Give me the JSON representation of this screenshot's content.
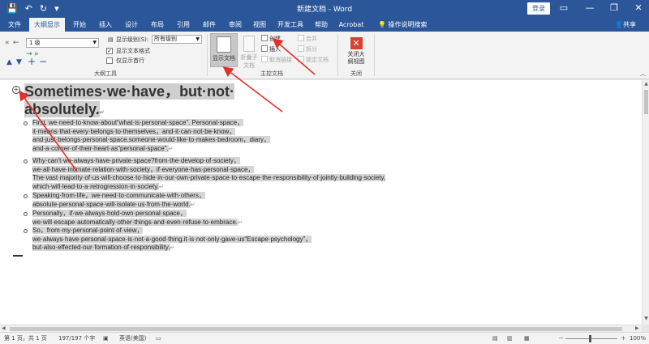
{
  "window": {
    "title": "新建文档 - Word",
    "login_label": "登录",
    "controls": [
      "▭",
      "—",
      "❐",
      "✕"
    ]
  },
  "qat": [
    "💾",
    "↶",
    "↻",
    "▾"
  ],
  "menu": {
    "tabs": [
      "文件",
      "大纲显示",
      "开始",
      "插入",
      "设计",
      "布局",
      "引用",
      "邮件",
      "审阅",
      "视图",
      "开发工具",
      "帮助",
      "Acrobat"
    ],
    "active_index": 1,
    "tellme": "操作说明搜索",
    "share": "共享"
  },
  "ribbon": {
    "outline_tools": {
      "level_value": "1 级",
      "show_level_label": "显示级别(S):",
      "show_level_value": "所有级别",
      "show_text_format": "显示文本格式",
      "show_first_line_only": "仅显示首行",
      "text_format_checked": true,
      "first_line_checked": false,
      "group_label": "大纲工具"
    },
    "master_document": {
      "show_document": "显示文档",
      "collapse_subdocs": "折叠子文档",
      "create": "创建",
      "insert": "插入",
      "unlink": "取消链接",
      "merge": "合并",
      "split": "拆分",
      "lock_document": "锁定文档",
      "group_label": "主控文档"
    },
    "close": {
      "close_outline_view": "关闭大纲视图",
      "group_label": "关闭"
    }
  },
  "document": {
    "heading_line1": "Sometimes·we·have，but·not·",
    "heading_line2": "absolutely.",
    "heading_mark": "↵",
    "paragraphs": [
      "First, we·need·to·know·about“what·is·personal·space”. Personal·space，it·means·that·every·belongs·to·themselves，and·it·can·not·be·know，and·just·belongs·personal·space.someone·would·like·to·makes·bedroom，diary，and·a·corner·of·their·heart·as“personal·space”.",
      "Why·can't·we·always·have·private·space?from·the·develop·of·society，we·all·have·intimate·relation·with·society，if·everyone·has·personal·space，The·vast·majority·of·us·will·choose·to·hide·in·our·own·private·space·to·escape·the·responsibility·of·jointly·building·society, which·will·lead·to·a·retrogression·in·society.",
      "Speaking·from·life，we·need·to·communicate·with·others，absolute·personal·space·will·isolate·us·from·the·world.",
      "Personally，if·we·always·hold·own·personal·space，we·will·escape·automatically·other·things·and·even·refuse·to·embrace.",
      "So，from·my·personal·point·of·view，we·always·have·personal·space·is·not·a·good·thing.it·is·not·only·gave·us“Escape·psychology”，but·also·effected·our·formation·of·responsibility."
    ],
    "para_mark": "↵"
  },
  "status": {
    "page": "第 1 页，共 1 页",
    "words": "197/197 个字",
    "language": "英语(美国)",
    "zoom": "100%",
    "zoom_minus": "－",
    "zoom_plus": "＋"
  },
  "colors": {
    "titlebar": "#2b579a",
    "arrow_red": "#e0322b",
    "highlight_gray": "#d6d6d6"
  }
}
